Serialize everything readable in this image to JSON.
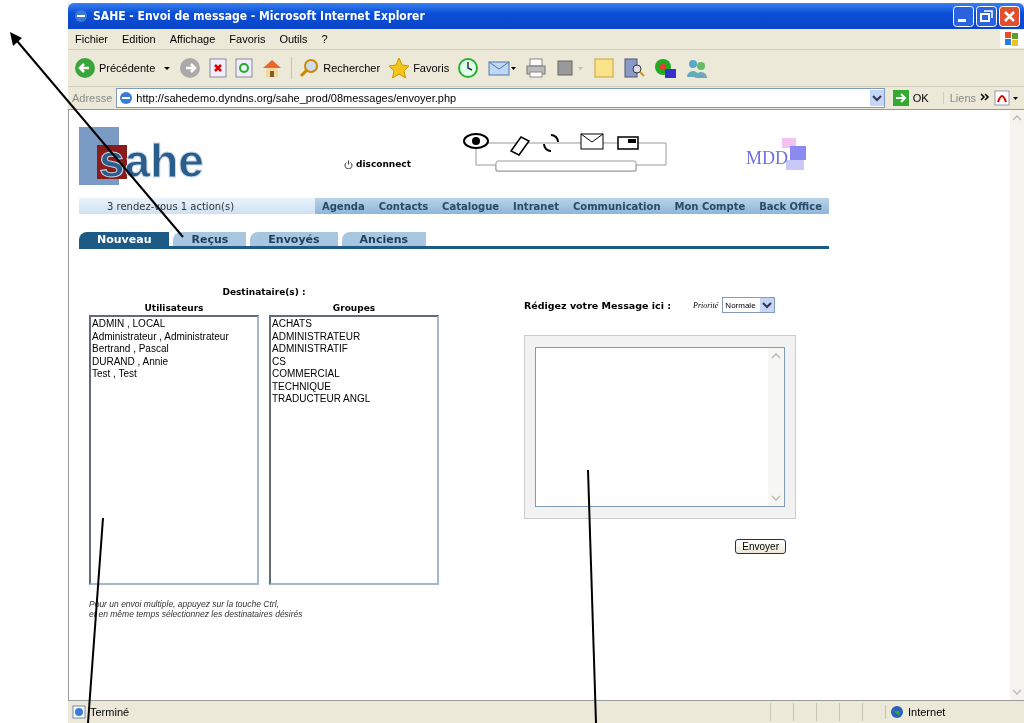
{
  "window": {
    "title": "SAHE - Envoi de message - Microsoft Internet Explorer"
  },
  "menu": [
    "Fichier",
    "Edition",
    "Affichage",
    "Favoris",
    "Outils",
    "?"
  ],
  "toolbar": {
    "back": "Précédente",
    "search": "Rechercher",
    "favorites": "Favoris"
  },
  "address": {
    "label": "Adresse",
    "url": "http://sahedemo.dyndns.org/sahe_prod/08messages/envoyer.php",
    "go": "OK",
    "links": "Liens"
  },
  "page": {
    "logo": "sahe",
    "partner_logo": "MDD",
    "disconnect": "disconnect",
    "counts": "3 rendez-vous  1 action(s)",
    "nav": [
      "Agenda",
      "Contacts",
      "Catalogue",
      "Intranet",
      "Communication",
      "Mon Compte",
      "Back Office"
    ],
    "tabs": [
      {
        "label": "Nouveau",
        "selected": true
      },
      {
        "label": "Reçus",
        "selected": false
      },
      {
        "label": "Envoyés",
        "selected": false
      },
      {
        "label": "Anciens",
        "selected": false
      }
    ],
    "recipients_label": "Destinataire(s) :",
    "users": {
      "heading": "Utilisateurs",
      "items": [
        "ADMIN , LOCAL",
        "Administrateur , Administrateur",
        "Bertrand , Pascal",
        "DURAND , Annie",
        "Test , Test"
      ]
    },
    "groups": {
      "heading": "Groupes",
      "items": [
        "ACHATS",
        "ADMINISTRATEUR",
        "ADMINISTRATIF",
        "CS",
        "COMMERCIAL",
        "TECHNIQUE",
        "TRADUCTEUR ANGL"
      ]
    },
    "hint": [
      "Pour un envoi multiple, appuyez sur la touche Ctrl,",
      "et en même temps sélectionnez les destinataires désirés"
    ],
    "compose_label": "Rédigez votre Message ici :",
    "priority_label": "Priorité",
    "priority": "Normale",
    "send": "Envoyer"
  },
  "status_bar": {
    "text": "Terminé",
    "zone": "Internet"
  }
}
